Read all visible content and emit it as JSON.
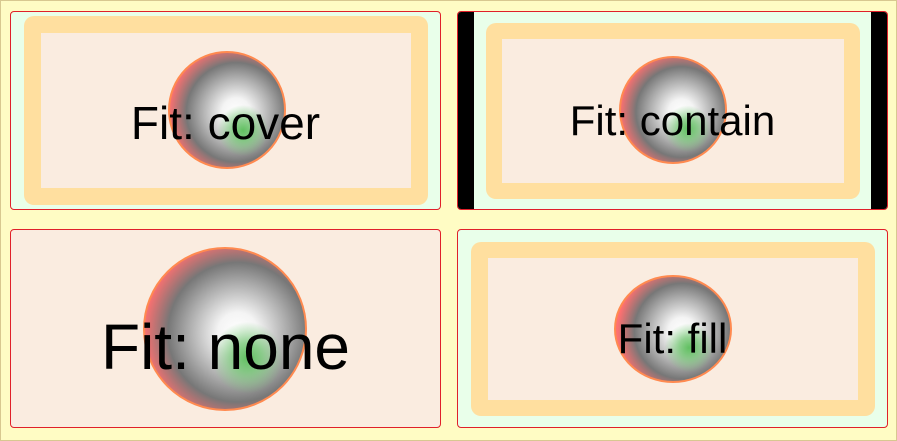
{
  "panels": {
    "cover": {
      "label": "Fit: cover"
    },
    "contain": {
      "label": "Fit: contain"
    },
    "none": {
      "label": "Fit: none"
    },
    "fill": {
      "label": "Fit: fill"
    }
  },
  "colors": {
    "page_background": "#fffcc4",
    "panel_border": "#e0202a",
    "image_frame": "#ffdf9f",
    "image_fill": "#faece0",
    "circle_rim": "#ff8a50",
    "letterbox": "#000000"
  },
  "icons": [
    "gradient-circle-image"
  ]
}
